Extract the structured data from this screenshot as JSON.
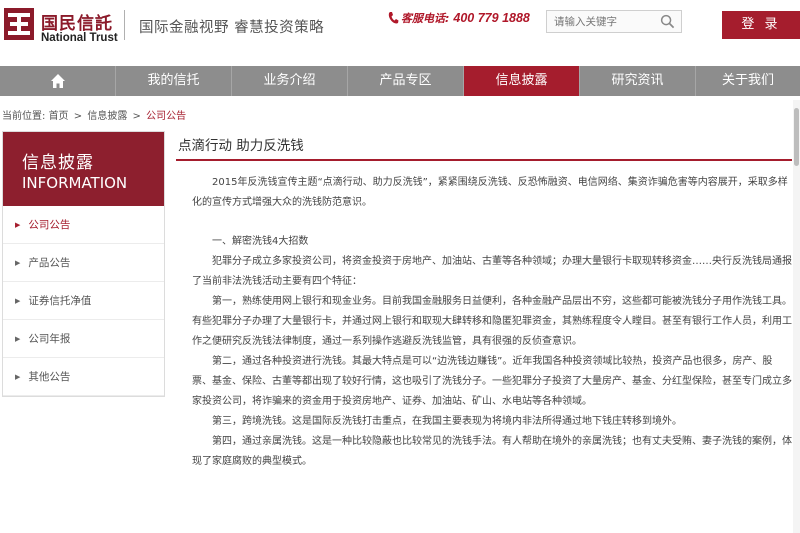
{
  "brand": {
    "name_cn": "国民信託",
    "name_en": "National Trust",
    "slogan": "国际金融视野  睿慧投资策略"
  },
  "hotline": {
    "label": "客服电话:",
    "number": "400 779 1888"
  },
  "search": {
    "placeholder": "请输入关键字"
  },
  "login": {
    "label": "登 录"
  },
  "nav": {
    "items": [
      {
        "label": "我的信托"
      },
      {
        "label": "业务介绍"
      },
      {
        "label": "产品专区"
      },
      {
        "label": "信息披露"
      },
      {
        "label": "研究资讯"
      },
      {
        "label": "关于我们"
      }
    ],
    "active_index": 3
  },
  "breadcrumb": {
    "prefix": "当前位置:",
    "items": [
      "首页",
      "信息披露",
      "公司公告"
    ],
    "separator": ">"
  },
  "sidebar": {
    "title": "信息披露",
    "subtitle": "INFORMATION",
    "items": [
      {
        "label": "公司公告"
      },
      {
        "label": "产品公告"
      },
      {
        "label": "证券信托净值"
      },
      {
        "label": "公司年报"
      },
      {
        "label": "其他公告"
      }
    ],
    "active_index": 0
  },
  "article": {
    "title": "点滴行动 助力反洗钱",
    "paragraphs": [
      "2015年反洗钱宣传主题“点滴行动、助力反洗钱”，紧紧围绕反洗钱、反恐怖融资、电信网络、集资诈骗危害等内容展开，采取多样化的宣传方式增强大众的洗钱防范意识。",
      "一、解密洗钱4大招数",
      "犯罪分子成立多家投资公司，将资金投资于房地产、加油站、古董等各种领域；办理大量银行卡取现转移资金……央行反洗钱局通报了当前非法洗钱活动主要有四个特征：",
      "第一，熟练使用网上银行和现金业务。目前我国金融服务日益便利，各种金融产品层出不穷，这些都可能被洗钱分子用作洗钱工具。有些犯罪分子办理了大量银行卡，并通过网上银行和取现大肆转移和隐匿犯罪资金，其熟练程度令人瞠目。甚至有银行工作人员，利用工作之便研究反洗钱法律制度，通过一系列操作逃避反洗钱监管，具有很强的反侦查意识。",
      "第二，通过各种投资进行洗钱。其最大特点是可以“边洗钱边赚钱”。近年我国各种投资领域比较热，投资产品也很多，房产、股票、基金、保险、古董等都出现了较好行情，这也吸引了洗钱分子。一些犯罪分子投资了大量房产、基金、分红型保险，甚至专门成立多家投资公司，将诈骗来的资金用于投资房地产、证券、加油站、矿山、水电站等各种领域。",
      "第三，跨境洗钱。这是国际反洗钱打击重点，在我国主要表现为将境内非法所得通过地下钱庄转移到境外。",
      "第四，通过亲属洗钱。这是一种比较隐蔽也比较常见的洗钱手法。有人帮助在境外的亲属洗钱；也有丈夫受贿、妻子洗钱的案例，体现了家庭腐败的典型模式。"
    ]
  },
  "colors": {
    "brand_red": "#a51d2d",
    "sidebar_red": "#8d1f2e",
    "nav_gray": "#8d8d8d"
  },
  "icons": {
    "logo": "logo-mark-icon",
    "phone": "phone-icon",
    "search": "search-icon",
    "home": "home-icon",
    "sidebar_arrow": "triangle-right-icon"
  }
}
